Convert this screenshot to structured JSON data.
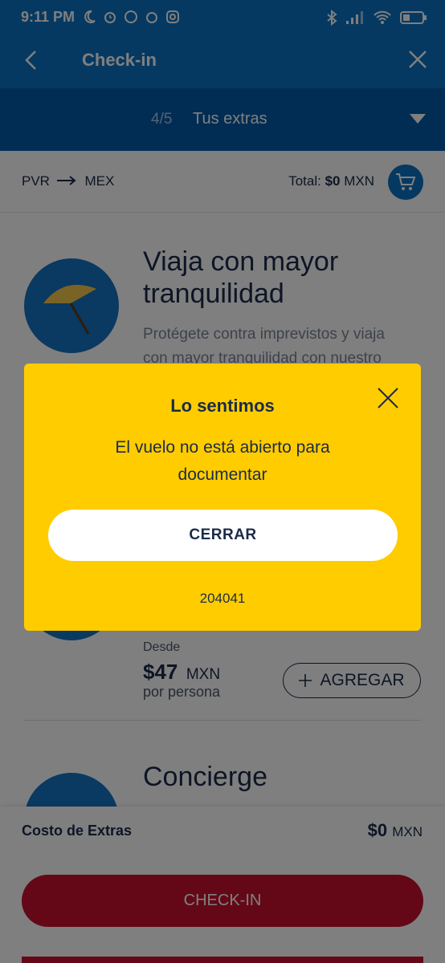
{
  "status_bar": {
    "time": "9:11 PM"
  },
  "header": {
    "title": "Check-in"
  },
  "steps": {
    "number": "4/5",
    "label": "Tus extras"
  },
  "route": {
    "origin": "PVR",
    "destination": "MEX",
    "total_label": "Total:",
    "total_value": "$0",
    "currency": "MXN"
  },
  "cards": [
    {
      "title_line1": "Viaja con mayor",
      "title_line2": "tranquilidad",
      "desc_line1": "Protégete contra imprevistos y viaja",
      "desc_line2": "con mayor tranquilidad con nuestro"
    },
    {
      "from_label": "Desde",
      "price": "$47",
      "currency": "MXN",
      "per": "por persona",
      "add_label": "AGREGAR"
    },
    {
      "title": "Concierge"
    }
  ],
  "footer": {
    "extras_label": "Costo de Extras",
    "extras_value": "$0",
    "extras_currency": "MXN",
    "checkin_label": "CHECK-IN"
  },
  "modal": {
    "title": "Lo sentimos",
    "message_line1": "El vuelo no está abierto para",
    "message_line2": "documentar",
    "button_label": "CERRAR",
    "code": "204041"
  },
  "colors": {
    "primary_blue": "#0b73c2",
    "dark_blue": "#035aa8",
    "modal_yellow": "#ffcc00",
    "checkin_red": "#c8102e"
  }
}
